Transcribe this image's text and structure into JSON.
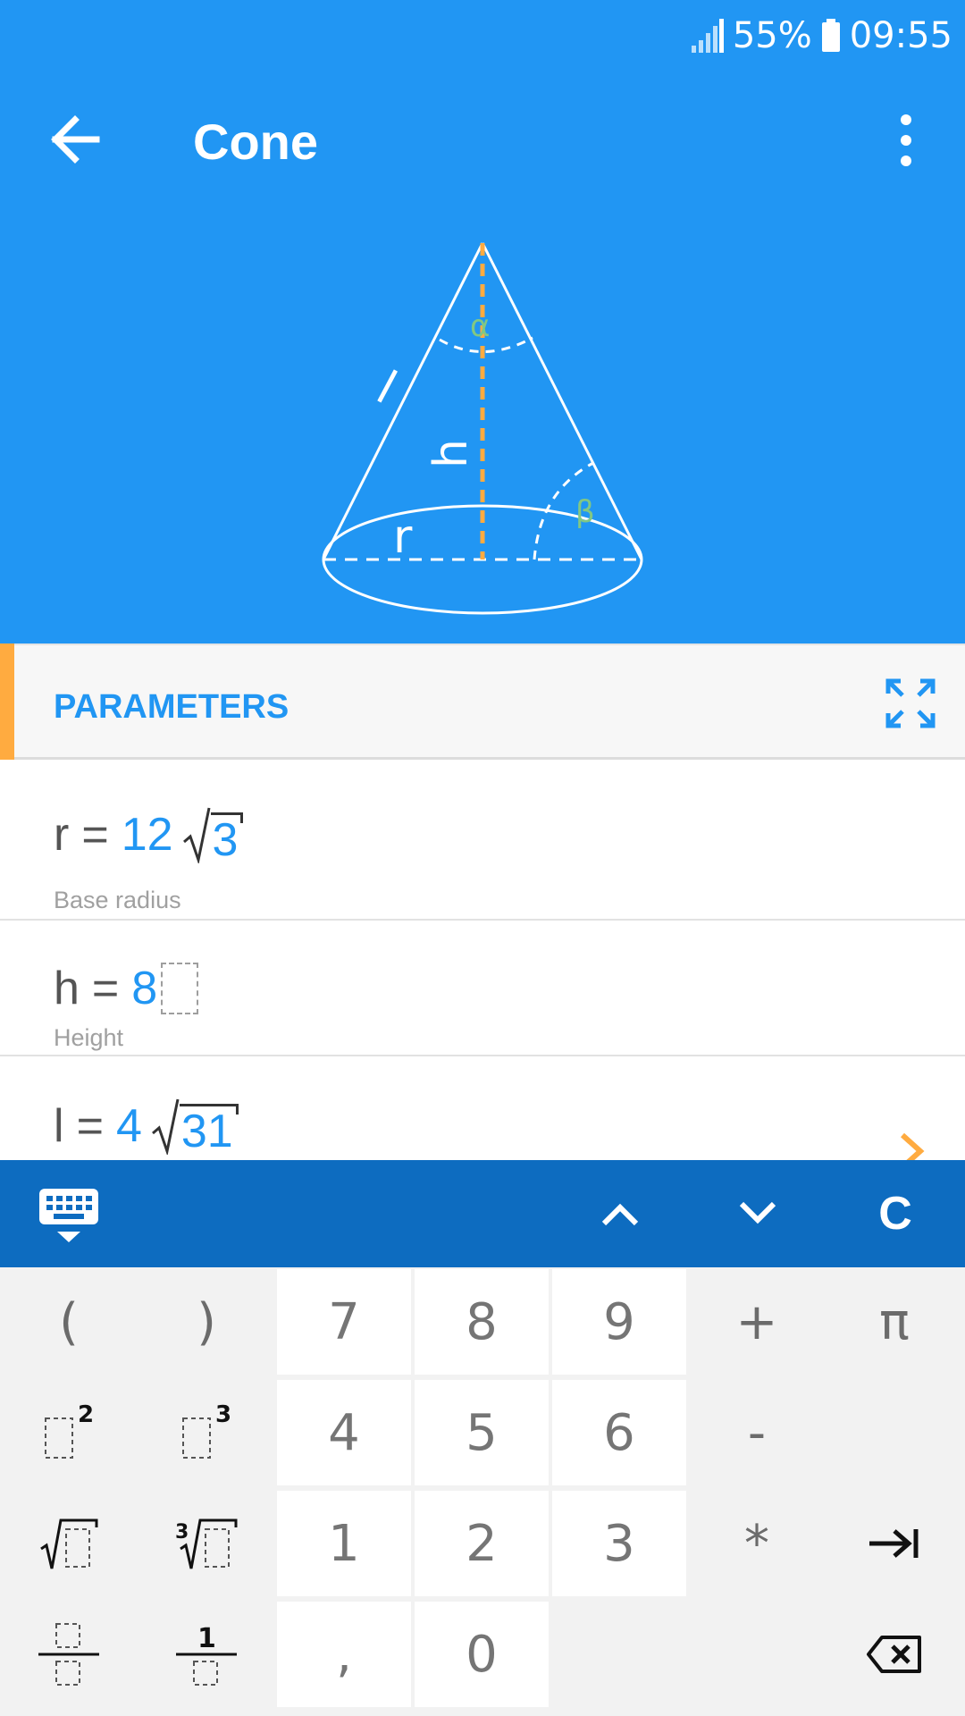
{
  "status_bar": {
    "battery_percent": "55%",
    "time": "09:55"
  },
  "app_bar": {
    "title": "Cone"
  },
  "figure": {
    "labels": {
      "slant": "l",
      "height": "h",
      "radius": "r",
      "apex_angle": "α",
      "base_angle": "β"
    }
  },
  "parameters": {
    "title": "PARAMETERS",
    "items": [
      {
        "variable": "r",
        "equals": "=",
        "coefficient": "12",
        "radicand": "3",
        "description": "Base radius",
        "accent": "#FFAB40"
      },
      {
        "variable": "h",
        "equals": "=",
        "value": "8",
        "description": "Height",
        "accent": "#2196F3"
      },
      {
        "variable": "l",
        "equals": "=",
        "coefficient": "4",
        "radicand": "31",
        "accent": "#81C784"
      }
    ]
  },
  "keyboard_toolbar": {
    "up_icon": "chevron-up-icon",
    "down_icon": "chevron-down-icon",
    "clear_label": "C"
  },
  "keypad": {
    "rows": [
      [
        "(",
        ")",
        "7",
        "8",
        "9",
        "+",
        "π"
      ],
      [
        "x²",
        "x³",
        "4",
        "5",
        "6",
        "-",
        ""
      ],
      [
        "√x",
        "∛x",
        "1",
        "2",
        "3",
        "*",
        "tab"
      ],
      [
        "a/b",
        "1/x",
        ",",
        "0",
        "",
        "",
        "backspace"
      ]
    ],
    "labels": {
      "open_paren": "(",
      "close_paren": ")",
      "seven": "7",
      "eight": "8",
      "nine": "9",
      "plus": "+",
      "pi": "π",
      "four": "4",
      "five": "5",
      "six": "6",
      "minus": "-",
      "one": "1",
      "two": "2",
      "three": "3",
      "multiply": "*",
      "comma": ",",
      "zero": "0",
      "square_exp": "2",
      "cube_exp": "3",
      "cube_root_index": "3",
      "reciprocal_numerator": "1"
    }
  },
  "colors": {
    "primary": "#2196F3",
    "toolbar": "#0D6CC0",
    "accent_orange": "#FFAB40",
    "accent_green": "#81C784"
  }
}
